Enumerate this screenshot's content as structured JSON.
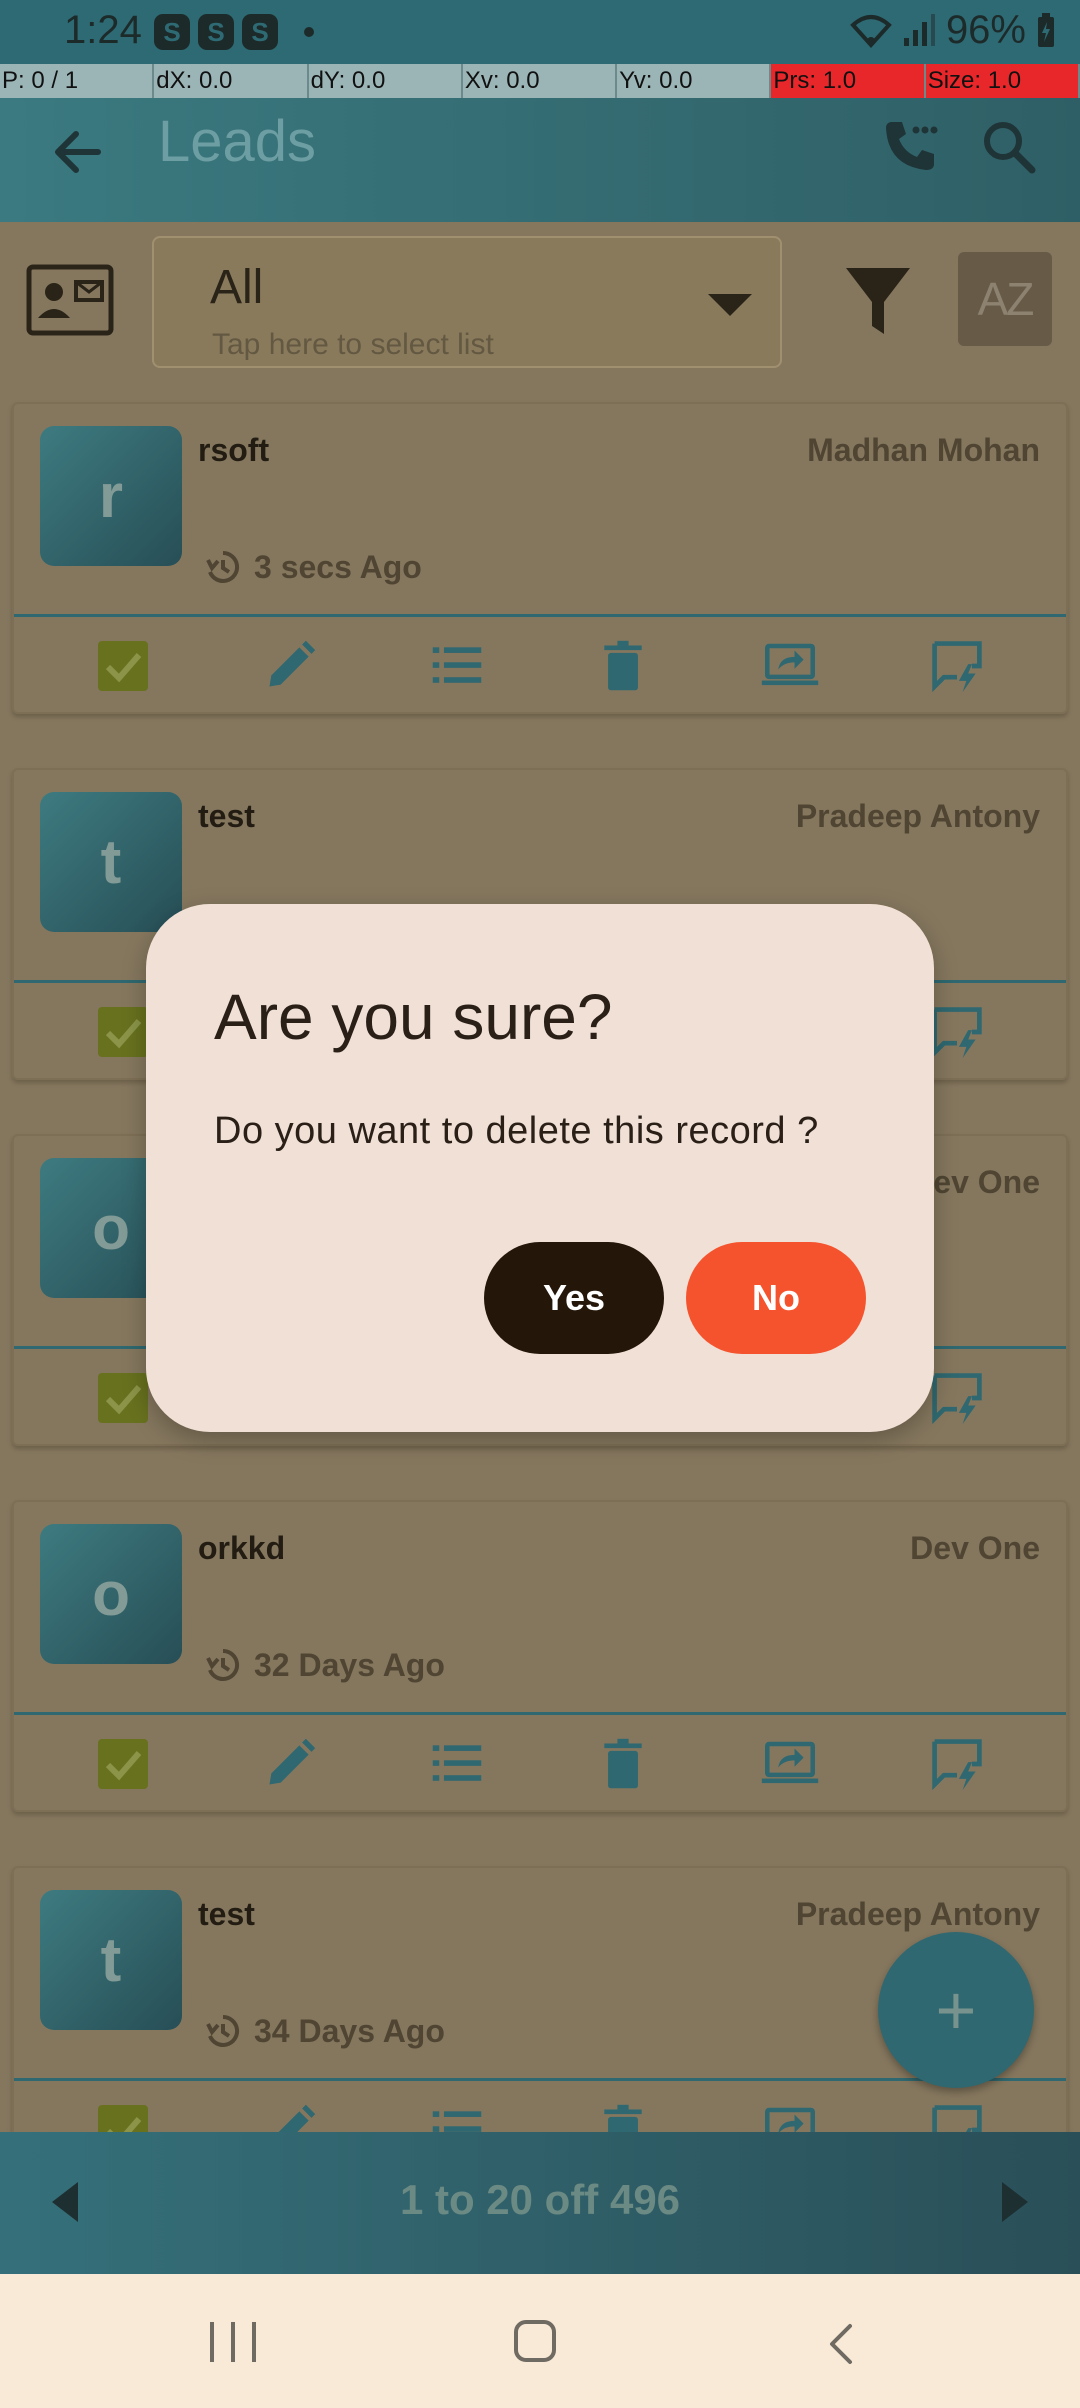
{
  "status_bar": {
    "time": "1:24",
    "badge_letter": "S",
    "battery": "96%"
  },
  "debug_overlay": {
    "p": "P: 0 / 1",
    "dx": "dX: 0.0",
    "dy": "dY: 0.0",
    "xv": "Xv: 0.0",
    "yv": "Yv: 0.0",
    "prs": "Prs: 1.0",
    "size": "Size: 1.0"
  },
  "appbar": {
    "title": "Leads"
  },
  "filter": {
    "selected": "All",
    "hint": "Tap here to select list",
    "sort_label": "AZ"
  },
  "leads": [
    {
      "initial": "r",
      "name": "rsoft",
      "owner": "Madhan Mohan",
      "time": "3 secs Ago"
    },
    {
      "initial": "t",
      "name": "test",
      "owner": "Pradeep Antony",
      "time": ""
    },
    {
      "initial": "o",
      "name": "",
      "owner": "Dev One",
      "time": ""
    },
    {
      "initial": "o",
      "name": "orkkd",
      "owner": "Dev One",
      "time": "32 Days Ago"
    },
    {
      "initial": "t",
      "name": "test",
      "owner": "Pradeep Antony",
      "time": "34 Days Ago"
    }
  ],
  "fab": {
    "label": "+"
  },
  "pagination": {
    "text": "1 to 20 off 496"
  },
  "dialog": {
    "title": "Are you sure?",
    "message": "Do you want to delete this record ?",
    "yes_label": "Yes",
    "no_label": "No"
  },
  "colors": {
    "accent": "#2f6870",
    "yes_button": "#24170a",
    "no_button": "#f4532d",
    "dialog_bg": "#f1e0d6"
  }
}
